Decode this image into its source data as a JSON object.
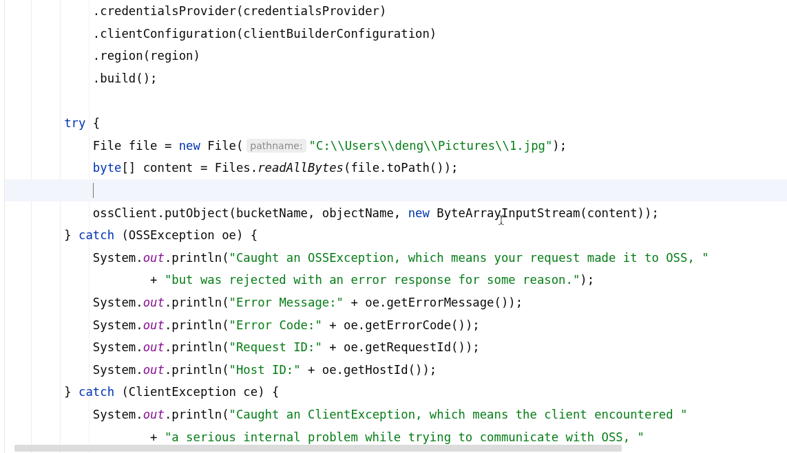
{
  "editor": {
    "lines": [
      {
        "continuation": true,
        "current": false,
        "tokens": [
          {
            "kind": "plain",
            "text": ".credentialsProvider(credentialsProvider)"
          }
        ]
      },
      {
        "continuation": true,
        "current": false,
        "tokens": [
          {
            "kind": "plain",
            "text": ".clientConfiguration(clientBuilderConfiguration)"
          }
        ]
      },
      {
        "continuation": true,
        "current": false,
        "tokens": [
          {
            "kind": "plain",
            "text": ".region(region)"
          }
        ]
      },
      {
        "continuation": true,
        "current": false,
        "tokens": [
          {
            "kind": "plain",
            "text": ".build();"
          }
        ]
      },
      {
        "current": false
      },
      {
        "continuation": false,
        "current": false,
        "tokens": [
          {
            "kind": "keyword",
            "text": "try"
          },
          {
            "kind": "plain",
            "text": " {"
          }
        ],
        "children": [
          {
            "continuation": false,
            "current": false,
            "tokens": [
              {
                "kind": "plain",
                "text": "File file = "
              },
              {
                "kind": "keyword",
                "text": "new"
              },
              {
                "kind": "plain",
                "text": " File("
              },
              {
                "kind": "hint",
                "text": "pathname:"
              },
              {
                "kind": "string",
                "text": "\"C:\\\\Users\\\\deng\\\\Pictures\\\\1.jpg\""
              },
              {
                "kind": "plain",
                "text": ");"
              }
            ]
          },
          {
            "continuation": false,
            "current": false,
            "tokens": [
              {
                "kind": "keyword",
                "text": "byte"
              },
              {
                "kind": "plain",
                "text": "[] content = Files."
              },
              {
                "kind": "italic",
                "text": "readAllBytes"
              },
              {
                "kind": "plain",
                "text": "(file.toPath());"
              }
            ]
          },
          {
            "continuation": false,
            "current": true
          },
          {
            "continuation": false,
            "current": false,
            "tokens": [
              {
                "kind": "plain",
                "text": "ossClient.putObject(bucketName, objectName, "
              },
              {
                "kind": "keyword",
                "text": "new"
              },
              {
                "kind": "plain",
                "text": " ByteArrayInputStream(content));"
              }
            ]
          }
        ]
      },
      {
        "continuation": false,
        "current": false,
        "tokens": [
          {
            "kind": "plain",
            "text": "} "
          },
          {
            "kind": "keyword",
            "text": "catch"
          },
          {
            "kind": "plain",
            "text": " (OSSException oe) {"
          }
        ],
        "children": [
          {
            "continuation": false,
            "current": false,
            "tokens": [
              {
                "kind": "plain",
                "text": "System."
              },
              {
                "kind": "static",
                "text": "out"
              },
              {
                "kind": "plain",
                "text": ".println("
              },
              {
                "kind": "string",
                "text": "\"Caught an OSSException, which means your request made it to OSS, \""
              }
            ],
            "children": [
              {
                "continuation": true,
                "current": false,
                "tokens": [
                  {
                    "kind": "plain",
                    "text": "+ "
                  },
                  {
                    "kind": "string",
                    "text": "\"but was rejected with an error response for some reason.\""
                  },
                  {
                    "kind": "plain",
                    "text": ");"
                  }
                ]
              }
            ]
          },
          {
            "continuation": false,
            "current": false,
            "tokens": [
              {
                "kind": "plain",
                "text": "System."
              },
              {
                "kind": "static",
                "text": "out"
              },
              {
                "kind": "plain",
                "text": ".println("
              },
              {
                "kind": "string",
                "text": "\"Error Message:\""
              },
              {
                "kind": "plain",
                "text": " + oe.getErrorMessage());"
              }
            ]
          },
          {
            "continuation": false,
            "current": false,
            "tokens": [
              {
                "kind": "plain",
                "text": "System."
              },
              {
                "kind": "static",
                "text": "out"
              },
              {
                "kind": "plain",
                "text": ".println("
              },
              {
                "kind": "string",
                "text": "\"Error Code:\""
              },
              {
                "kind": "plain",
                "text": " + oe.getErrorCode());"
              }
            ]
          },
          {
            "continuation": false,
            "current": false,
            "tokens": [
              {
                "kind": "plain",
                "text": "System."
              },
              {
                "kind": "static",
                "text": "out"
              },
              {
                "kind": "plain",
                "text": ".println("
              },
              {
                "kind": "string",
                "text": "\"Request ID:\""
              },
              {
                "kind": "plain",
                "text": " + oe.getRequestId());"
              }
            ]
          },
          {
            "continuation": false,
            "current": false,
            "tokens": [
              {
                "kind": "plain",
                "text": "System."
              },
              {
                "kind": "static",
                "text": "out"
              },
              {
                "kind": "plain",
                "text": ".println("
              },
              {
                "kind": "string",
                "text": "\"Host ID:\""
              },
              {
                "kind": "plain",
                "text": " + oe.getHostId());"
              }
            ]
          }
        ]
      },
      {
        "continuation": false,
        "current": false,
        "tokens": [
          {
            "kind": "plain",
            "text": "} "
          },
          {
            "kind": "keyword",
            "text": "catch"
          },
          {
            "kind": "plain",
            "text": " (ClientException ce) {"
          }
        ],
        "children": [
          {
            "continuation": false,
            "current": false,
            "tokens": [
              {
                "kind": "plain",
                "text": "System."
              },
              {
                "kind": "static",
                "text": "out"
              },
              {
                "kind": "plain",
                "text": ".println("
              },
              {
                "kind": "string",
                "text": "\"Caught an ClientException, which means the client encountered \""
              }
            ],
            "children": [
              {
                "continuation": true,
                "current": false,
                "tokens": [
                  {
                    "kind": "plain",
                    "text": "+ "
                  },
                  {
                    "kind": "string",
                    "text": "\"a serious internal problem while trying to communicate with OSS, \""
                  }
                ]
              }
            ]
          }
        ]
      }
    ]
  }
}
